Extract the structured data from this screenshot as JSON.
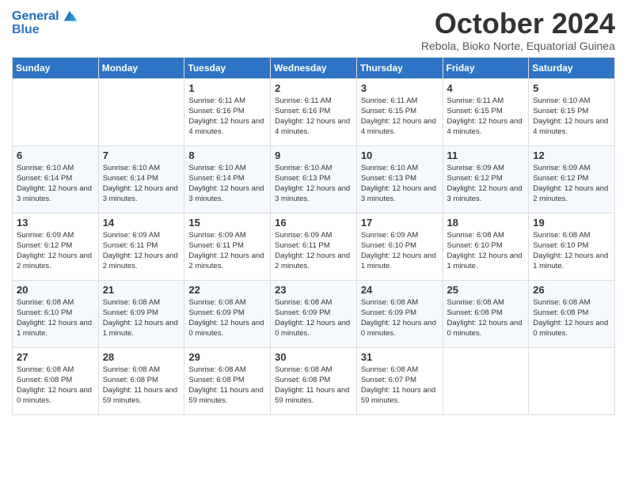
{
  "header": {
    "logo_line1": "General",
    "logo_line2": "Blue",
    "month_title": "October 2024",
    "location": "Rebola, Bioko Norte, Equatorial Guinea"
  },
  "weekdays": [
    "Sunday",
    "Monday",
    "Tuesday",
    "Wednesday",
    "Thursday",
    "Friday",
    "Saturday"
  ],
  "weeks": [
    [
      {
        "day": "",
        "detail": ""
      },
      {
        "day": "",
        "detail": ""
      },
      {
        "day": "1",
        "detail": "Sunrise: 6:11 AM\nSunset: 6:16 PM\nDaylight: 12 hours and 4 minutes."
      },
      {
        "day": "2",
        "detail": "Sunrise: 6:11 AM\nSunset: 6:16 PM\nDaylight: 12 hours and 4 minutes."
      },
      {
        "day": "3",
        "detail": "Sunrise: 6:11 AM\nSunset: 6:15 PM\nDaylight: 12 hours and 4 minutes."
      },
      {
        "day": "4",
        "detail": "Sunrise: 6:11 AM\nSunset: 6:15 PM\nDaylight: 12 hours and 4 minutes."
      },
      {
        "day": "5",
        "detail": "Sunrise: 6:10 AM\nSunset: 6:15 PM\nDaylight: 12 hours and 4 minutes."
      }
    ],
    [
      {
        "day": "6",
        "detail": "Sunrise: 6:10 AM\nSunset: 6:14 PM\nDaylight: 12 hours and 3 minutes."
      },
      {
        "day": "7",
        "detail": "Sunrise: 6:10 AM\nSunset: 6:14 PM\nDaylight: 12 hours and 3 minutes."
      },
      {
        "day": "8",
        "detail": "Sunrise: 6:10 AM\nSunset: 6:14 PM\nDaylight: 12 hours and 3 minutes."
      },
      {
        "day": "9",
        "detail": "Sunrise: 6:10 AM\nSunset: 6:13 PM\nDaylight: 12 hours and 3 minutes."
      },
      {
        "day": "10",
        "detail": "Sunrise: 6:10 AM\nSunset: 6:13 PM\nDaylight: 12 hours and 3 minutes."
      },
      {
        "day": "11",
        "detail": "Sunrise: 6:09 AM\nSunset: 6:12 PM\nDaylight: 12 hours and 3 minutes."
      },
      {
        "day": "12",
        "detail": "Sunrise: 6:09 AM\nSunset: 6:12 PM\nDaylight: 12 hours and 2 minutes."
      }
    ],
    [
      {
        "day": "13",
        "detail": "Sunrise: 6:09 AM\nSunset: 6:12 PM\nDaylight: 12 hours and 2 minutes."
      },
      {
        "day": "14",
        "detail": "Sunrise: 6:09 AM\nSunset: 6:11 PM\nDaylight: 12 hours and 2 minutes."
      },
      {
        "day": "15",
        "detail": "Sunrise: 6:09 AM\nSunset: 6:11 PM\nDaylight: 12 hours and 2 minutes."
      },
      {
        "day": "16",
        "detail": "Sunrise: 6:09 AM\nSunset: 6:11 PM\nDaylight: 12 hours and 2 minutes."
      },
      {
        "day": "17",
        "detail": "Sunrise: 6:09 AM\nSunset: 6:10 PM\nDaylight: 12 hours and 1 minute."
      },
      {
        "day": "18",
        "detail": "Sunrise: 6:08 AM\nSunset: 6:10 PM\nDaylight: 12 hours and 1 minute."
      },
      {
        "day": "19",
        "detail": "Sunrise: 6:08 AM\nSunset: 6:10 PM\nDaylight: 12 hours and 1 minute."
      }
    ],
    [
      {
        "day": "20",
        "detail": "Sunrise: 6:08 AM\nSunset: 6:10 PM\nDaylight: 12 hours and 1 minute."
      },
      {
        "day": "21",
        "detail": "Sunrise: 6:08 AM\nSunset: 6:09 PM\nDaylight: 12 hours and 1 minute."
      },
      {
        "day": "22",
        "detail": "Sunrise: 6:08 AM\nSunset: 6:09 PM\nDaylight: 12 hours and 0 minutes."
      },
      {
        "day": "23",
        "detail": "Sunrise: 6:08 AM\nSunset: 6:09 PM\nDaylight: 12 hours and 0 minutes."
      },
      {
        "day": "24",
        "detail": "Sunrise: 6:08 AM\nSunset: 6:09 PM\nDaylight: 12 hours and 0 minutes."
      },
      {
        "day": "25",
        "detail": "Sunrise: 6:08 AM\nSunset: 6:08 PM\nDaylight: 12 hours and 0 minutes."
      },
      {
        "day": "26",
        "detail": "Sunrise: 6:08 AM\nSunset: 6:08 PM\nDaylight: 12 hours and 0 minutes."
      }
    ],
    [
      {
        "day": "27",
        "detail": "Sunrise: 6:08 AM\nSunset: 6:08 PM\nDaylight: 12 hours and 0 minutes."
      },
      {
        "day": "28",
        "detail": "Sunrise: 6:08 AM\nSunset: 6:08 PM\nDaylight: 11 hours and 59 minutes."
      },
      {
        "day": "29",
        "detail": "Sunrise: 6:08 AM\nSunset: 6:08 PM\nDaylight: 11 hours and 59 minutes."
      },
      {
        "day": "30",
        "detail": "Sunrise: 6:08 AM\nSunset: 6:08 PM\nDaylight: 11 hours and 59 minutes."
      },
      {
        "day": "31",
        "detail": "Sunrise: 6:08 AM\nSunset: 6:07 PM\nDaylight: 11 hours and 59 minutes."
      },
      {
        "day": "",
        "detail": ""
      },
      {
        "day": "",
        "detail": ""
      }
    ]
  ]
}
